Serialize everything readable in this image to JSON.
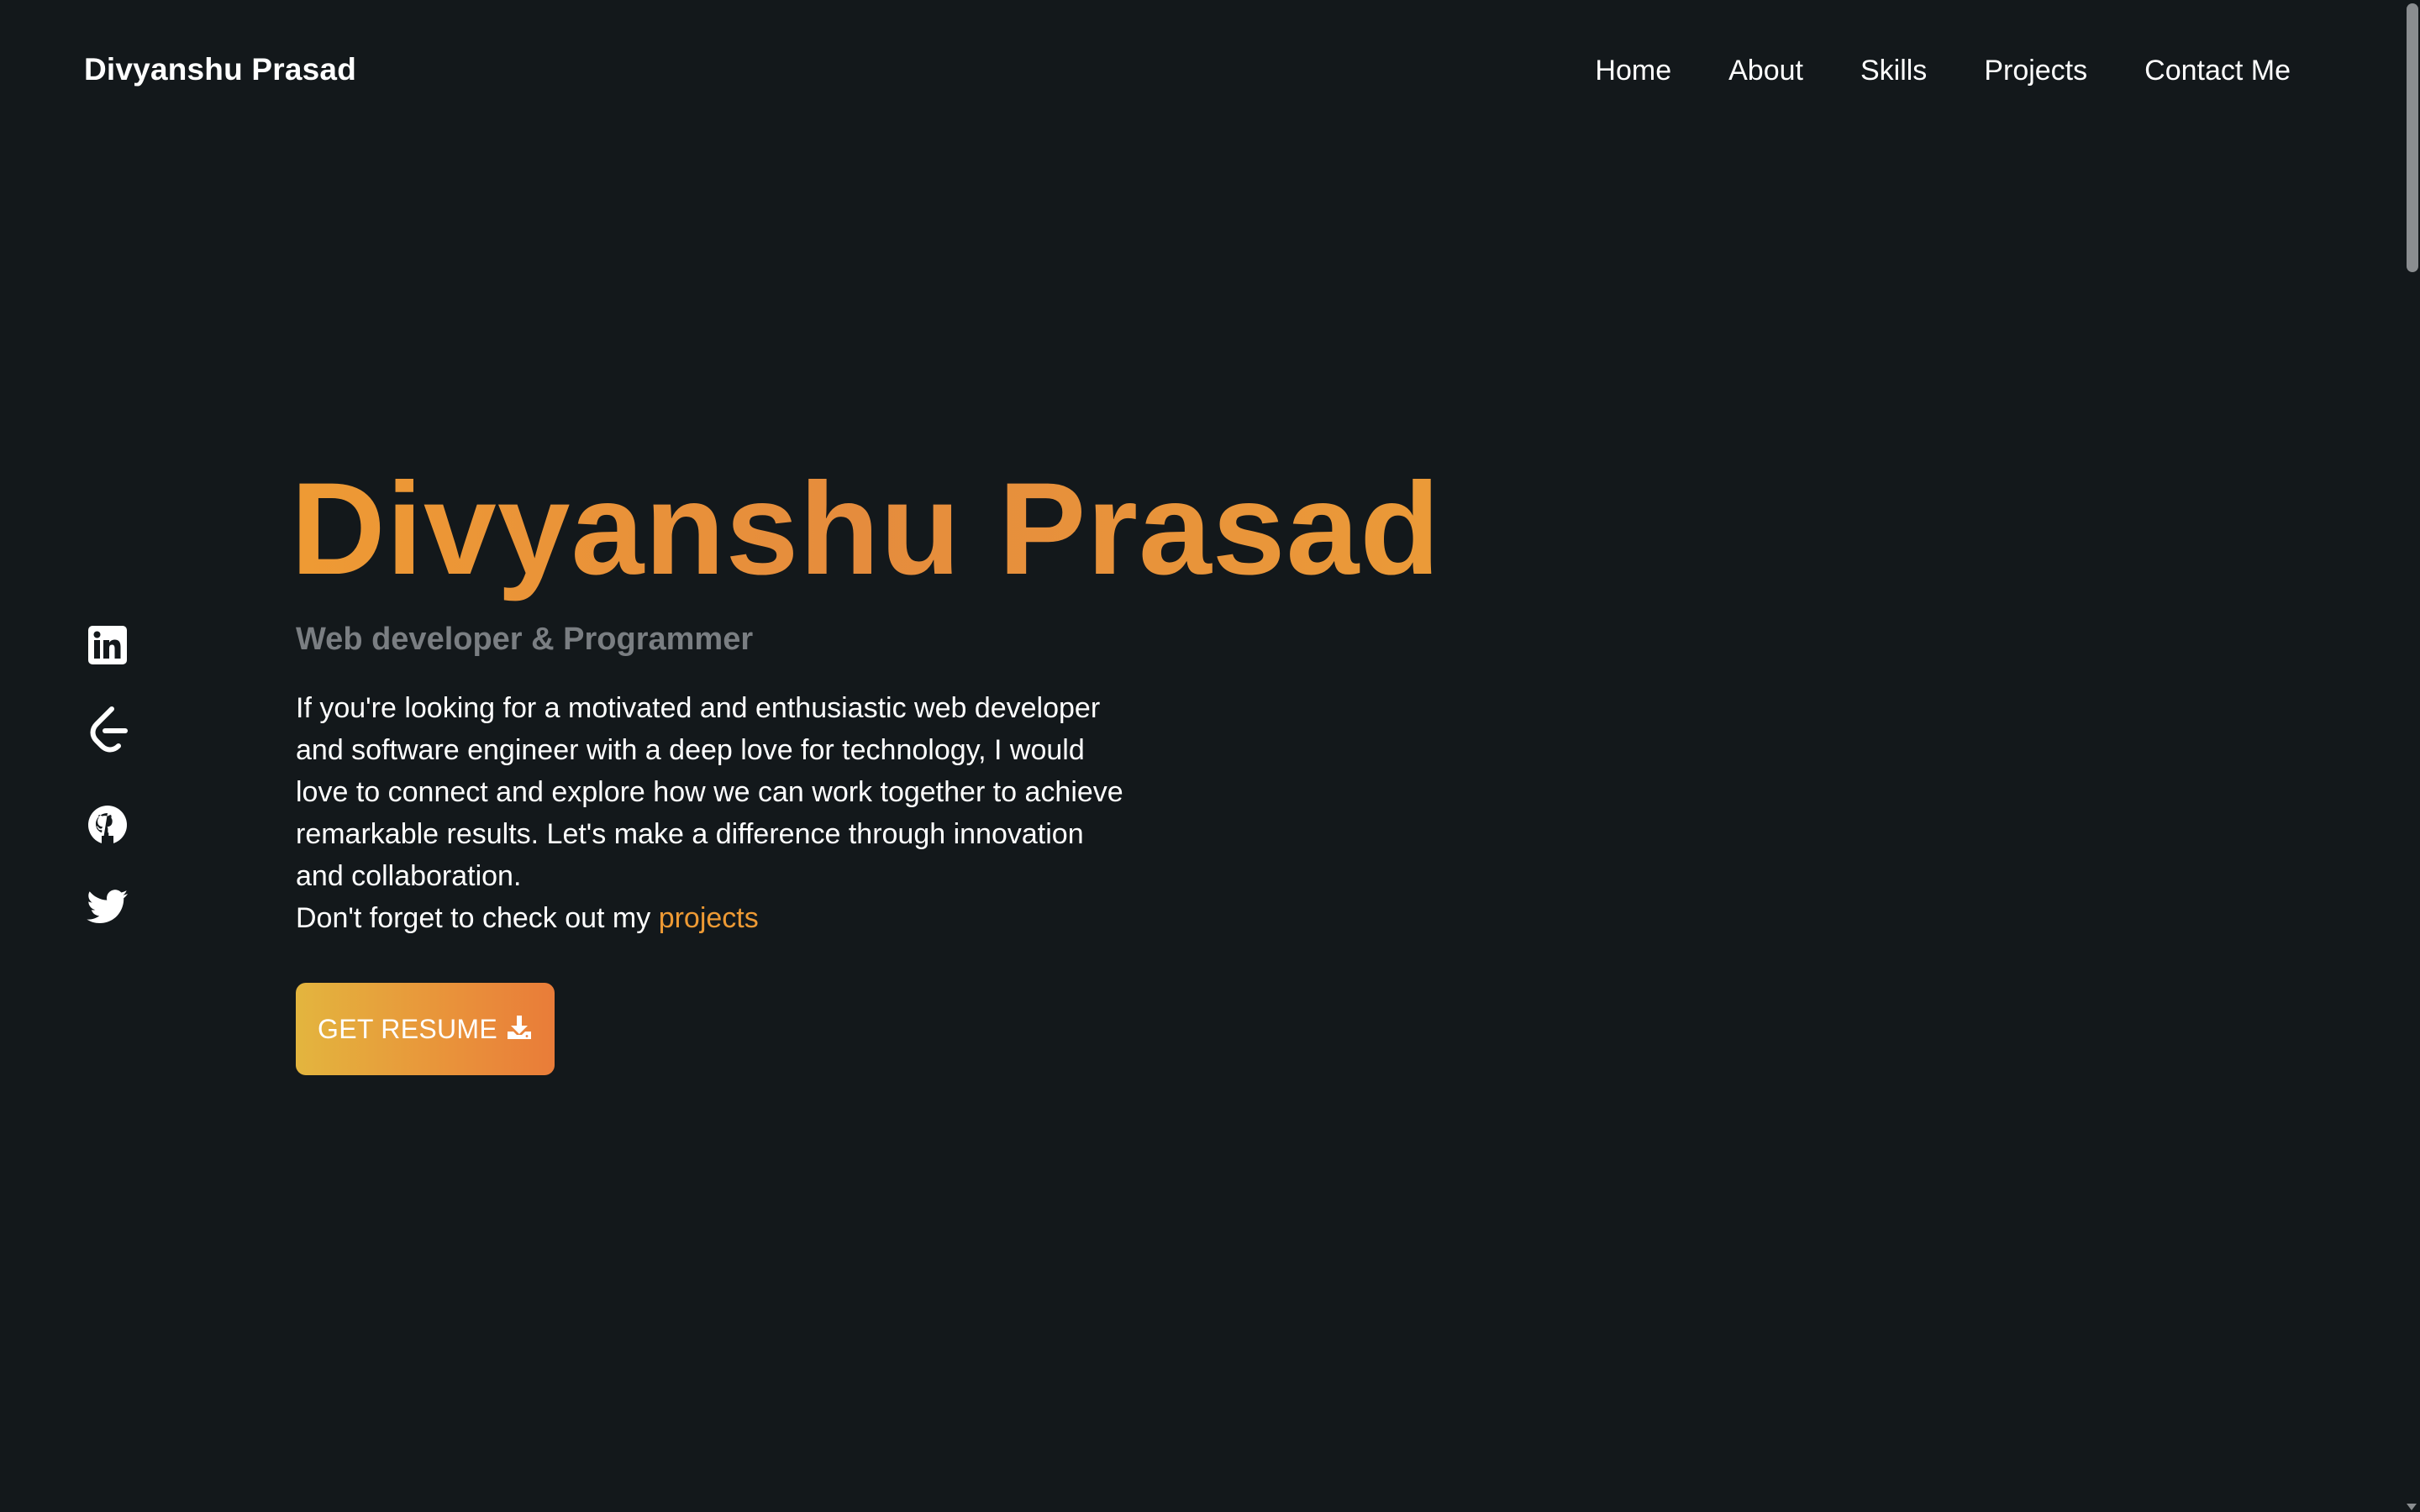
{
  "header": {
    "brand": "Divyanshu Prasad",
    "nav": [
      "Home",
      "About",
      "Skills",
      "Projects",
      "Contact Me"
    ]
  },
  "social": [
    {
      "icon": "linkedin-icon"
    },
    {
      "icon": "leetcode-icon"
    },
    {
      "icon": "github-icon"
    },
    {
      "icon": "twitter-icon"
    }
  ],
  "hero": {
    "name": "Divyanshu Prasad",
    "subtitle": "Web developer & Programmer",
    "description": "If you're looking for a motivated and enthusiastic web developer and software engineer with a deep love for technology, I would love to connect and explore how we can work together to achieve remarkable results. Let's make a difference through innovation and collaboration.",
    "cta_prefix": "Don't forget to check out my ",
    "cta_link": "projects",
    "resume_button": "GET RESUME"
  },
  "colors": {
    "background": "#13181b",
    "accent": "#ee9a34",
    "subtitle": "#7a7e82"
  }
}
